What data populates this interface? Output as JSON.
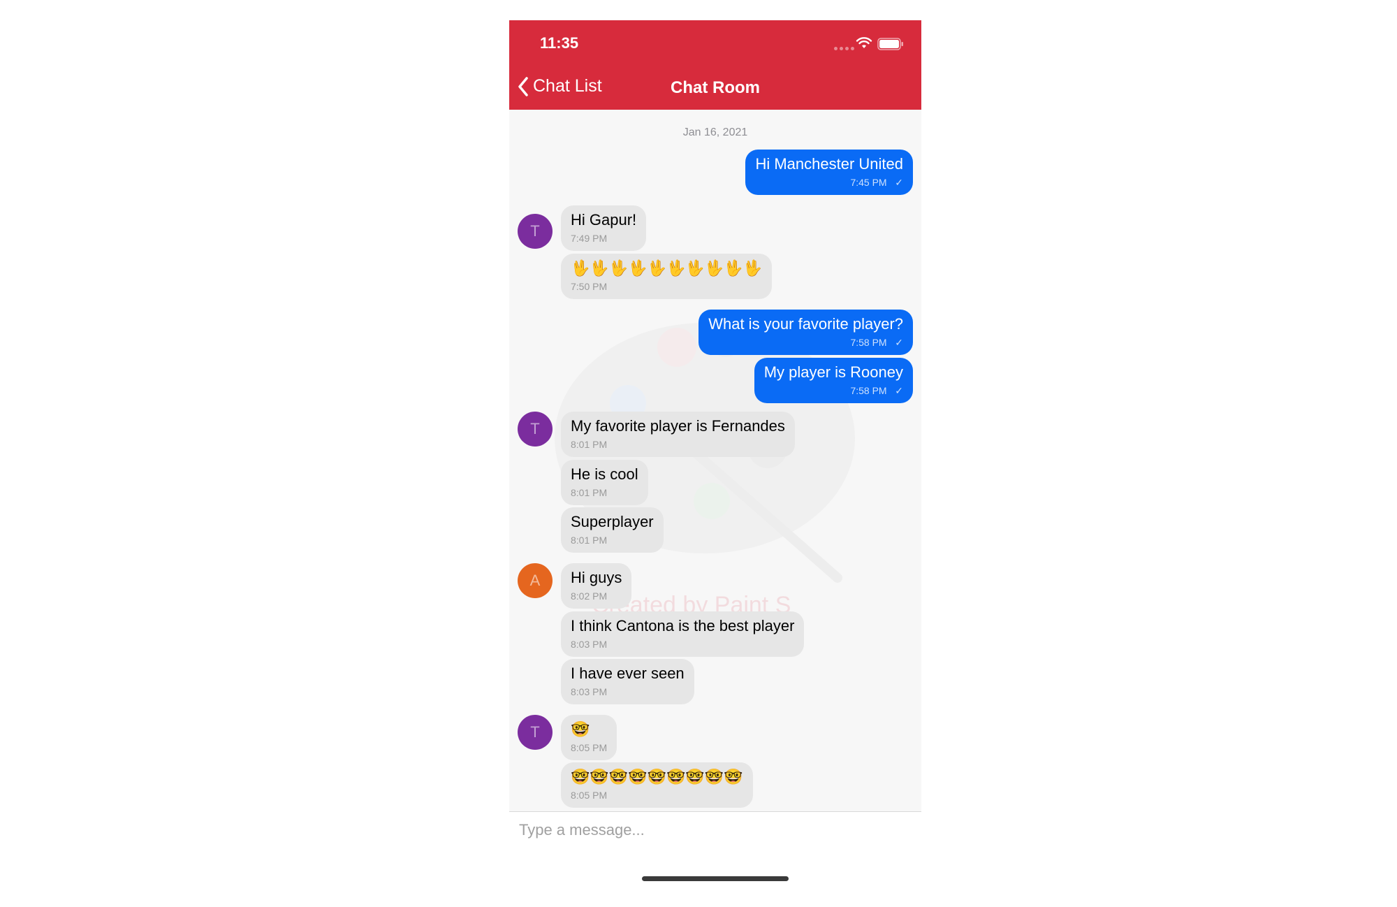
{
  "status_bar": {
    "time": "11:35"
  },
  "nav": {
    "back_label": "Chat List",
    "title": "Chat Room"
  },
  "chat": {
    "date": "Jan 16, 2021"
  },
  "watermark": {
    "text": "Created by Paint S"
  },
  "messages": [
    {
      "dir": "out",
      "text": "Hi Manchester United",
      "time": "7:45 PM",
      "status": "✓"
    },
    {
      "dir": "in",
      "avatar": "T",
      "text": "Hi Gapur!",
      "time": "7:49 PM"
    },
    {
      "dir": "in",
      "text": "🖖🖖🖖🖖🖖🖖🖖🖖🖖🖖",
      "time": "7:50 PM"
    },
    {
      "dir": "out",
      "text": "What is your favorite player?",
      "time": "7:58 PM",
      "status": "✓"
    },
    {
      "dir": "out",
      "text": "My player is Rooney",
      "time": "7:58 PM",
      "status": "✓"
    },
    {
      "dir": "in",
      "avatar": "T",
      "text": "My favorite player is Fernandes",
      "time": "8:01 PM"
    },
    {
      "dir": "in",
      "text": "He is cool",
      "time": "8:01 PM"
    },
    {
      "dir": "in",
      "text": "Superplayer",
      "time": "8:01 PM"
    },
    {
      "dir": "in",
      "avatar": "A",
      "text": "Hi guys",
      "time": "8:02 PM"
    },
    {
      "dir": "in",
      "text": "I think Cantona is the best player",
      "time": "8:03 PM"
    },
    {
      "dir": "in",
      "text": "I have ever seen",
      "time": "8:03 PM"
    },
    {
      "dir": "in",
      "avatar": "T",
      "text": "🤓",
      "time": "8:05 PM"
    },
    {
      "dir": "in",
      "text": "🤓🤓🤓🤓🤓🤓🤓🤓🤓",
      "time": "8:05 PM"
    }
  ],
  "composer": {
    "placeholder": "Type a message..."
  },
  "colors": {
    "header": "#d72b3c",
    "outgoing_bubble": "#0a6bf5",
    "incoming_bubble": "#e6e6e6",
    "avatar_t": "#7b2d9e",
    "avatar_a": "#e5661f"
  }
}
